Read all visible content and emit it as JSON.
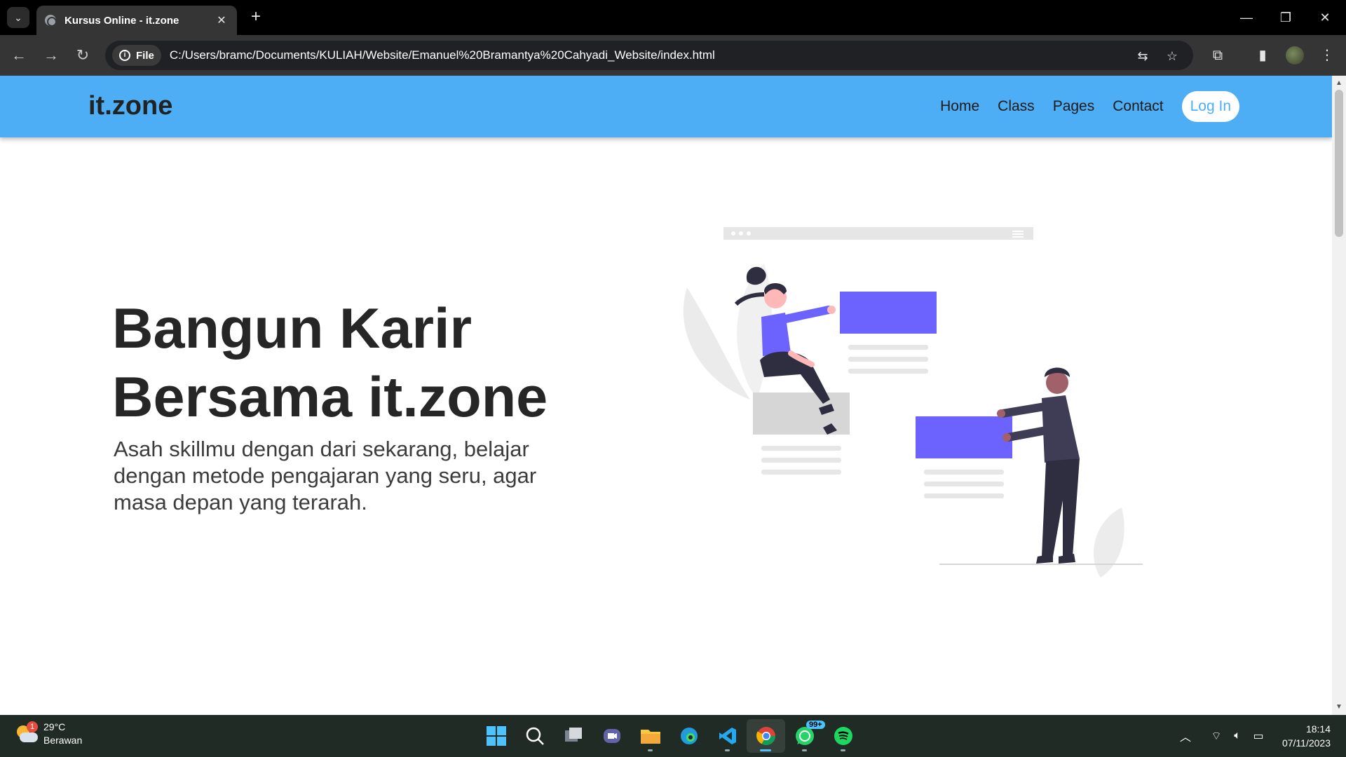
{
  "browser": {
    "tab_title": "Kursus Online - it.zone",
    "chip_label": "File",
    "url": "C:/Users/bramc/Documents/KULIAH/Website/Emanuel%20Bramantya%20Cahyadi_Website/index.html"
  },
  "site": {
    "logo": "it.zone",
    "nav": [
      "Home",
      "Class",
      "Pages",
      "Contact"
    ],
    "login": "Log In"
  },
  "hero": {
    "title_line1": "Bangun Karir",
    "title_line2": "Bersama it.zone",
    "subtitle": "Asah skillmu dengan dari sekarang, belajar dengan metode pengajaran yang seru, agar masa depan yang terarah."
  },
  "colors": {
    "nav_bg": "#4eaef5",
    "accent_purple": "#6c63ff",
    "text_dark": "#262626"
  },
  "taskbar": {
    "weather_temp": "29°C",
    "weather_desc": "Berawan",
    "weather_badge": "1",
    "whatsapp_badge": "99+",
    "time": "18:14",
    "date": "07/11/2023"
  }
}
